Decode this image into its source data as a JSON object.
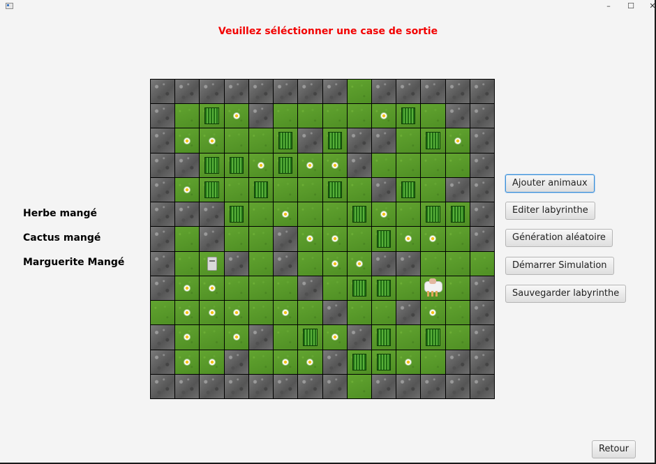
{
  "window": {
    "controls": [
      "–",
      "☐",
      "✕"
    ]
  },
  "header": {
    "instruction": "Veuillez séléctionner une case de sortie",
    "instruction_color": "#f20000"
  },
  "stats": [
    {
      "id": "grass",
      "label": "Herbe mangé"
    },
    {
      "id": "cactus",
      "label": "Cactus mangé"
    },
    {
      "id": "daisy",
      "label": "Marguerite Mangé"
    }
  ],
  "maze": {
    "cols": 14,
    "rows": 13,
    "legend": {
      "R": "rock",
      "G": "grass",
      "C": "cactus",
      "F": "flower",
      "W": "wolf",
      "S": "sheep"
    },
    "cells": [
      "RRRRRRRRGRRRRR",
      "RGCFRGGGGFCGRR",
      "RFFGGCRCRRGCFR",
      "RRCCFCFFRGGGGR",
      "RFCGCGGCGRCGRR",
      "RRRCGFGGCFGCCR",
      "RGRGGRFFGCFFGR",
      "RGWRGRGFFRRGGG",
      "RFFGGGRGCCGSGR",
      "GFFFGFGRGGRFGR",
      "RFGFRGCFRCGCGR",
      "RFFRGFFRCCFGRR",
      "RRRRRRRRGRRRRR"
    ]
  },
  "actions": {
    "add_animals": "Ajouter animaux",
    "edit_maze": "Editer labyrinthe",
    "random_generation": "Génération aléatoire",
    "start_simulation": "Démarrer Simulation",
    "save_maze": "Sauvegarder labyrinthe",
    "back": "Retour"
  }
}
